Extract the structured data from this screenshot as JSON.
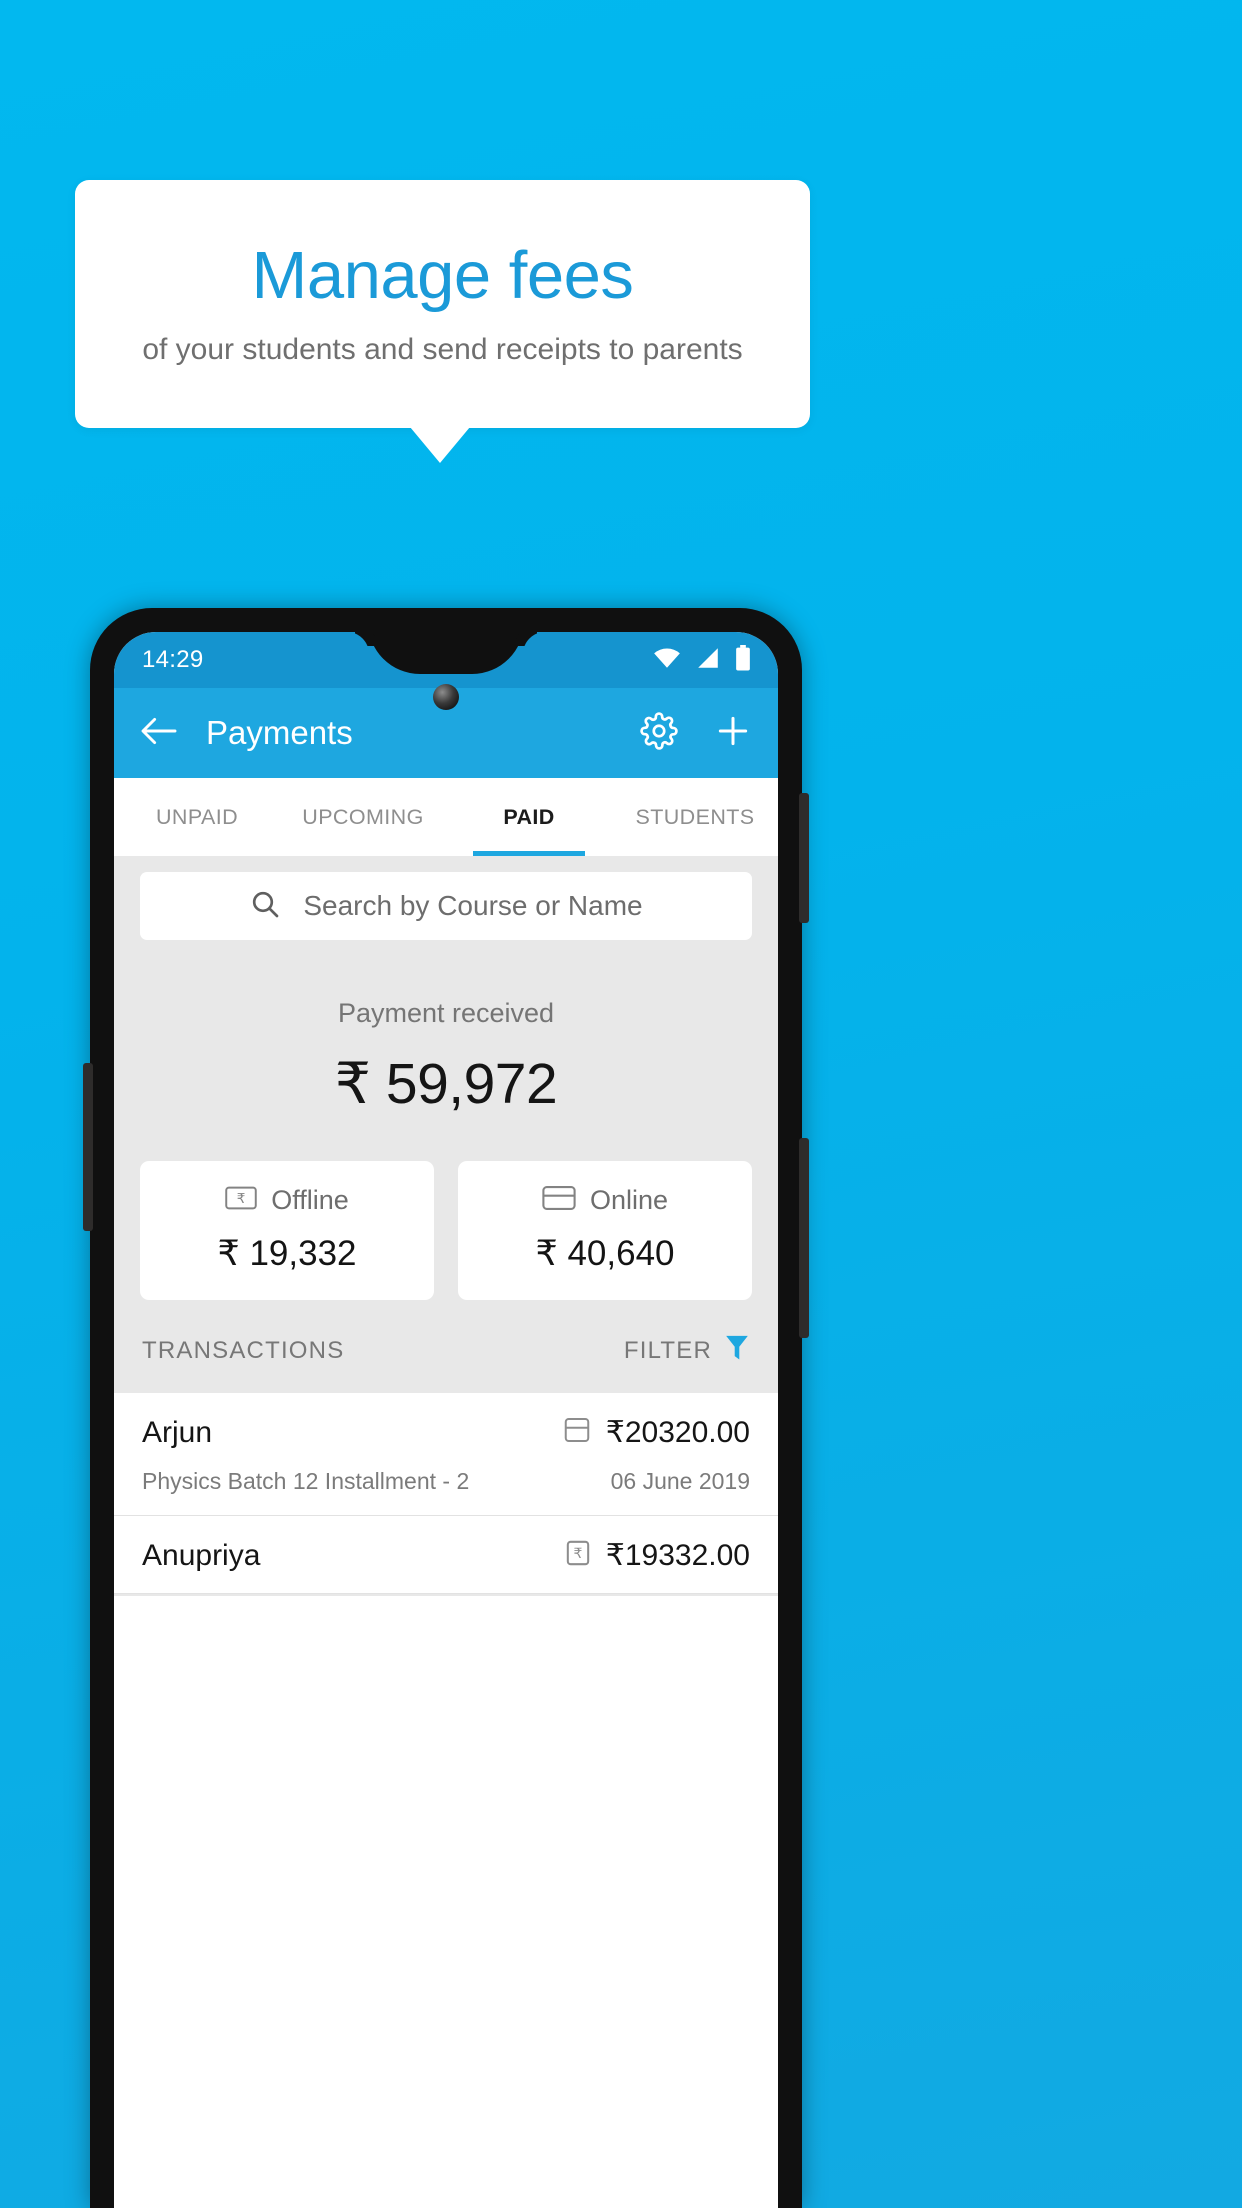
{
  "promo": {
    "title": "Manage fees",
    "subtitle": "of your students and send receipts to parents",
    "accent_color": "#1b9ad8",
    "background_color": "#03b3ec"
  },
  "phone": {
    "status_bar": {
      "time": "14:29",
      "icons": [
        "wifi-icon",
        "signal-icon",
        "battery-icon"
      ],
      "background_color": "#1594cf"
    },
    "app_bar": {
      "back_icon": "back-arrow-icon",
      "title": "Payments",
      "settings_icon": "gear-icon",
      "add_icon": "plus-icon",
      "background_color": "#1ea7e0"
    },
    "tabs": [
      {
        "label": "UNPAID",
        "active": false
      },
      {
        "label": "UPCOMING",
        "active": false
      },
      {
        "label": "PAID",
        "active": true
      },
      {
        "label": "STUDENTS",
        "active": false
      }
    ],
    "search": {
      "icon": "search-icon",
      "placeholder": "Search by Course or Name",
      "value": ""
    },
    "summary": {
      "label": "Payment received",
      "amount": "₹ 59,972"
    },
    "methods": [
      {
        "icon": "cash-note-icon",
        "label": "Offline",
        "amount": "₹ 19,332"
      },
      {
        "icon": "credit-card-icon",
        "label": "Online",
        "amount": "₹ 40,640"
      }
    ],
    "transactions_header": {
      "label": "TRANSACTIONS",
      "filter_label": "FILTER",
      "filter_icon": "funnel-icon",
      "filter_color": "#1ea7e0"
    },
    "transactions": [
      {
        "name": "Arjun",
        "method_icon": "credit-card-icon",
        "amount": "₹20320.00",
        "course": "Physics Batch 12 Installment - 2",
        "date": "06 June 2019"
      },
      {
        "name": "Anupriya",
        "method_icon": "cash-note-icon",
        "amount": "₹19332.00",
        "course": "",
        "date": ""
      }
    ]
  }
}
